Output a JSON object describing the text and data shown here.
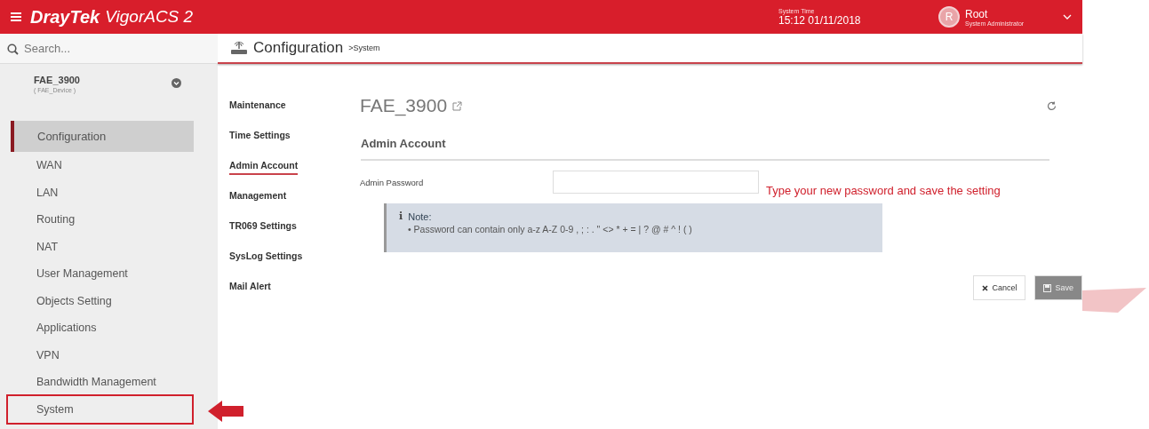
{
  "header": {
    "brand": "DrayTek",
    "product": "VigorACS",
    "version": "2",
    "time_label": "System Time",
    "time": "15:12 01/11/2018",
    "avatar": "R",
    "user": "Root",
    "role": "System Administrator"
  },
  "search": {
    "placeholder": "Search..."
  },
  "device": {
    "name": "FAE_3900",
    "group": "( FAE_Device )"
  },
  "sidebar": {
    "items": [
      {
        "label": "Configuration",
        "kind": "heading",
        "selected": false
      },
      {
        "label": "WAN",
        "kind": "item",
        "selected": false
      },
      {
        "label": "LAN",
        "kind": "item",
        "selected": false
      },
      {
        "label": "Routing",
        "kind": "item",
        "selected": false
      },
      {
        "label": "NAT",
        "kind": "item",
        "selected": false
      },
      {
        "label": "User Management",
        "kind": "item",
        "selected": false
      },
      {
        "label": "Objects Setting",
        "kind": "item",
        "selected": false
      },
      {
        "label": "Applications",
        "kind": "item",
        "selected": false
      },
      {
        "label": "VPN",
        "kind": "item",
        "selected": false
      },
      {
        "label": "Bandwidth Management",
        "kind": "item",
        "selected": false
      },
      {
        "label": "System",
        "kind": "item",
        "selected": true
      }
    ]
  },
  "breadcrumb": {
    "title": "Configuration",
    "sub": ">System"
  },
  "subnav": [
    {
      "label": "Maintenance",
      "selected": false
    },
    {
      "label": "Time Settings",
      "selected": false
    },
    {
      "label": "Admin Account",
      "selected": true
    },
    {
      "label": "Management",
      "selected": false
    },
    {
      "label": "TR069 Settings",
      "selected": false
    },
    {
      "label": "SysLog Settings",
      "selected": false
    },
    {
      "label": "Mail Alert",
      "selected": false
    }
  ],
  "device_title": "FAE_3900",
  "section": "Admin Account",
  "field": {
    "label": "Admin Password"
  },
  "annotation": "Type your new password and save the setting",
  "note": {
    "icon": "i",
    "title": "Note:",
    "bullet": "•",
    "items": [
      "Password can contain only a-z A-Z 0-9 , ; : . \" <> * + = | ? @ # ^ ! ( )"
    ]
  },
  "buttons": [
    {
      "label": "Cancel",
      "kind": "cancel"
    },
    {
      "label": "Save",
      "kind": "save"
    }
  ]
}
